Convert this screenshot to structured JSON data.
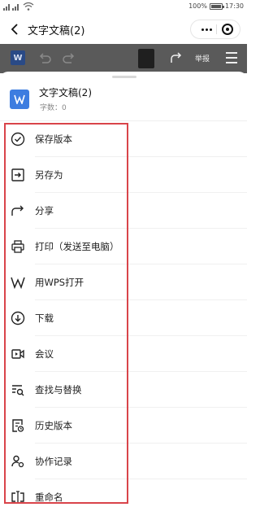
{
  "status_bar": {
    "left_text": "4G 4G",
    "battery": "100%",
    "time": "17:30"
  },
  "nav": {
    "title": "文字文稿(2)"
  },
  "toolbar": {
    "logo_text": "W",
    "report_label": "举报"
  },
  "document": {
    "icon_letter": "W",
    "title": "文字文稿(2)",
    "word_count": "字数：0"
  },
  "menu": {
    "items": [
      {
        "label": "保存版本",
        "icon": "check-circle-icon"
      },
      {
        "label": "另存为",
        "icon": "save-as-icon"
      },
      {
        "label": "分享",
        "icon": "share-icon"
      },
      {
        "label": "打印（发送至电脑）",
        "icon": "printer-icon"
      },
      {
        "label": "用WPS打开",
        "icon": "wps-icon"
      },
      {
        "label": "下载",
        "icon": "download-icon"
      },
      {
        "label": "会议",
        "icon": "video-meeting-icon"
      },
      {
        "label": "查找与替换",
        "icon": "find-replace-icon"
      },
      {
        "label": "历史版本",
        "icon": "history-version-icon"
      },
      {
        "label": "协作记录",
        "icon": "collaboration-record-icon"
      },
      {
        "label": "重命名",
        "icon": "rename-icon"
      }
    ]
  },
  "colors": {
    "highlight": "#d9444a",
    "doc_icon": "#3d7de0",
    "toolbar_dim": "#5a5a5a"
  }
}
